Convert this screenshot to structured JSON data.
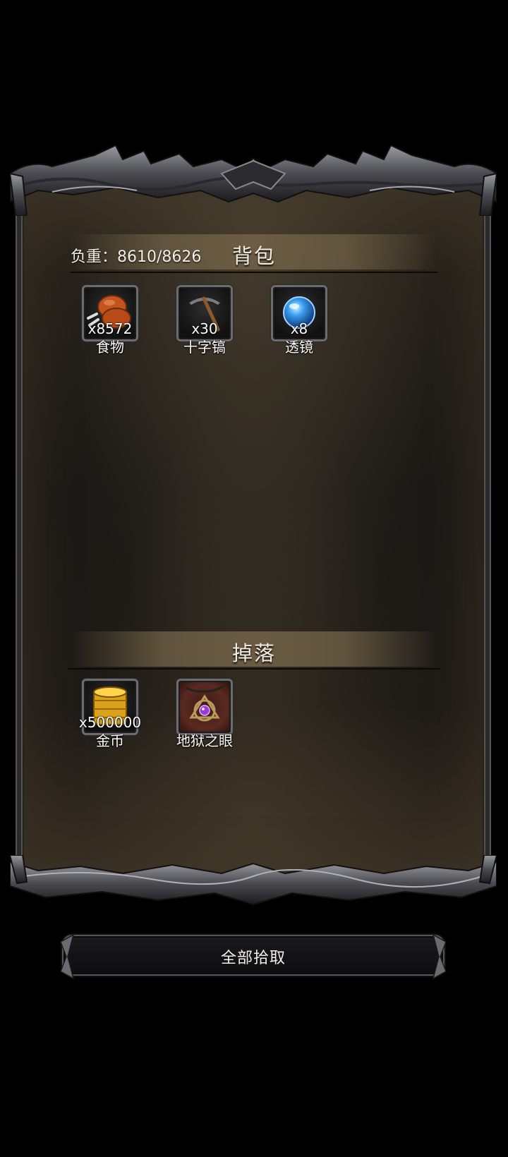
{
  "backpack": {
    "weight_label": "负重：8610/8626",
    "title": "背包",
    "items": [
      {
        "name": "食物",
        "count": "x8572",
        "icon": "meat-icon"
      },
      {
        "name": "十字镐",
        "count": "x30",
        "icon": "pickaxe-icon"
      },
      {
        "name": "透镜",
        "count": "x8",
        "icon": "blue-orb-icon"
      }
    ]
  },
  "drops": {
    "title": "掉落",
    "items": [
      {
        "name": "金币",
        "count": "x500000",
        "icon": "gold-coins-icon"
      },
      {
        "name": "地狱之眼",
        "count": "",
        "icon": "amulet-icon"
      }
    ]
  },
  "actions": {
    "pick_all_label": "全部拾取"
  },
  "colors": {
    "panel_bg": "#1c1916",
    "header_band": "#6e5e44",
    "frame_metal": "#6b6b70",
    "text": "#f1ece2"
  }
}
